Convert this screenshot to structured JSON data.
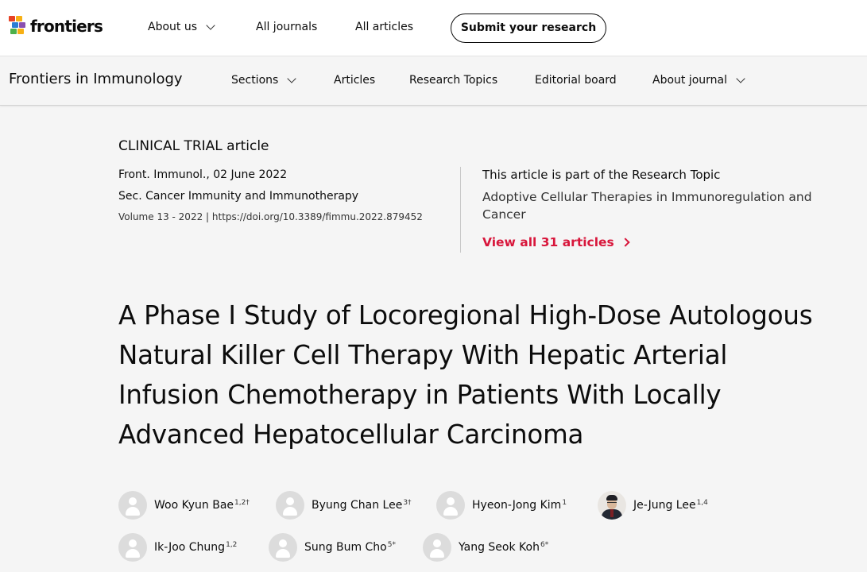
{
  "header": {
    "logo_text": "frontiers",
    "nav": [
      {
        "label": "About us",
        "has_dropdown": true
      },
      {
        "label": "All journals",
        "has_dropdown": false
      },
      {
        "label": "All articles",
        "has_dropdown": false
      }
    ],
    "submit_label": "Submit your research"
  },
  "journal_nav": {
    "journal_name": "Frontiers in Immunology",
    "items": [
      {
        "label": "Sections",
        "has_dropdown": true
      },
      {
        "label": "Articles",
        "has_dropdown": false
      },
      {
        "label": "Research Topics",
        "has_dropdown": false
      },
      {
        "label": "Editorial board",
        "has_dropdown": false
      },
      {
        "label": "About journal",
        "has_dropdown": true
      }
    ]
  },
  "article": {
    "type": "CLINICAL TRIAL article",
    "citation": "Front. Immunol., 02 June 2022",
    "section": "Sec. Cancer Immunity and Immunotherapy",
    "volume_doi": "Volume 13 - 2022 | https://doi.org/10.3389/fimmu.2022.879452",
    "title": "A Phase I Study of Locoregional High-Dose Autologous Natural Killer Cell Therapy With Hepatic Arterial Infusion Chemotherapy in Patients With Locally Advanced Hepatocellular Carcinoma"
  },
  "research_topic": {
    "label": "This article is part of the Research Topic",
    "name": "Adoptive Cellular Therapies in Immunoregulation and Cancer",
    "view_all": "View all 31 articles"
  },
  "authors": [
    {
      "name": "Woo Kyun Bae",
      "sup": "1,2†",
      "photo": false
    },
    {
      "name": "Byung Chan Lee",
      "sup": "3†",
      "photo": false
    },
    {
      "name": "Hyeon-Jong Kim",
      "sup": "1",
      "photo": false
    },
    {
      "name": "Je-Jung Lee",
      "sup": "1,4",
      "photo": true
    },
    {
      "name": "Ik-Joo Chung",
      "sup": "1,2",
      "photo": false
    },
    {
      "name": "Sung Bum Cho",
      "sup": "5*",
      "photo": false
    },
    {
      "name": "Yang Seok Koh",
      "sup": "6*",
      "photo": false
    }
  ],
  "colors": {
    "accent_red": "#d8163b",
    "logo_colors": [
      "#e74225",
      "#f7b014",
      "#2a7dd4",
      "#4db04a",
      "#8a4fb0"
    ]
  }
}
